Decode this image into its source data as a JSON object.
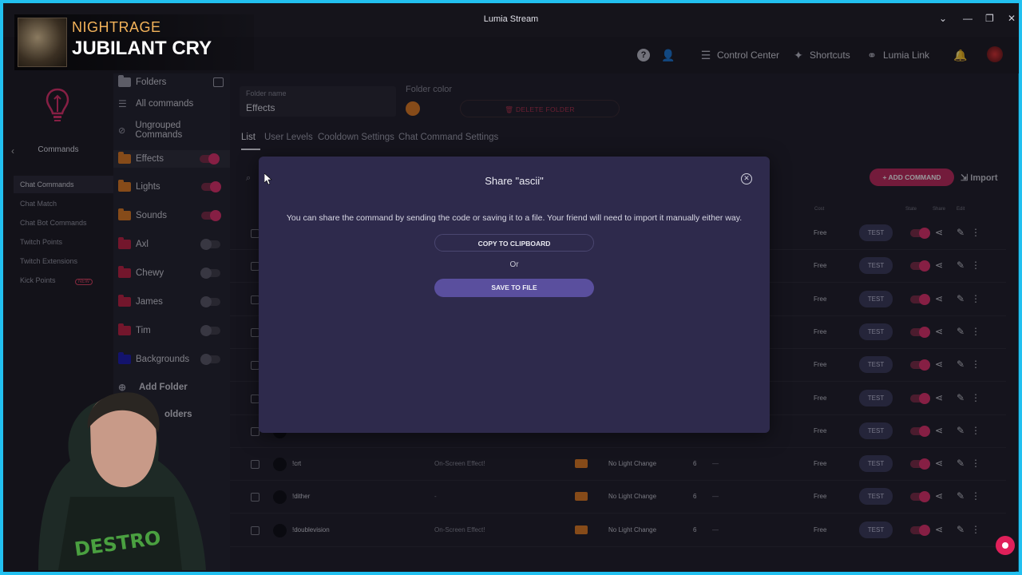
{
  "window": {
    "title": "Lumia Stream"
  },
  "now_playing": {
    "artist": "NIGHTRAGE",
    "song": "JUBILANT CRY"
  },
  "header": {
    "control_center": "Control Center",
    "shortcuts": "Shortcuts",
    "lumia_link": "Lumia Link"
  },
  "leftnav": {
    "title": "Commands",
    "items": [
      {
        "label": "Chat Commands"
      },
      {
        "label": "Chat Match"
      },
      {
        "label": "Chat Bot Commands"
      },
      {
        "label": "Twitch Points"
      },
      {
        "label": "Twitch Extensions"
      },
      {
        "label": "Kick Points",
        "badge": "NEW"
      }
    ]
  },
  "folders": {
    "header": "Folders",
    "all": "All commands",
    "ungrouped": "Ungrouped Commands",
    "list": [
      {
        "label": "Effects",
        "color": "#e07a20",
        "on": true
      },
      {
        "label": "Lights",
        "color": "#e07a20",
        "on": true
      },
      {
        "label": "Sounds",
        "color": "#e07a20",
        "on": true
      },
      {
        "label": "Axl",
        "color": "#c02040",
        "on": false
      },
      {
        "label": "Chewy",
        "color": "#c02040",
        "on": false
      },
      {
        "label": "James",
        "color": "#c02040",
        "on": false
      },
      {
        "label": "Tim",
        "color": "#c02040",
        "on": false
      },
      {
        "label": "Backgrounds",
        "color": "#1a1ab0",
        "on": false
      }
    ],
    "add_folder": "Add Folder",
    "folders_partial": "olders"
  },
  "main": {
    "folder_name_label": "Folder name",
    "folder_name_value": "Effects",
    "folder_color_label": "Folder color",
    "folder_color": "#e07a20",
    "delete_folder": "DELETE FOLDER",
    "tabs": [
      "List",
      "User Levels",
      "Cooldown Settings",
      "Chat Command Settings"
    ],
    "add_command": "ADD COMMAND",
    "import": "Import",
    "columns": {
      "cost": "Cost",
      "state": "State",
      "share": "Share",
      "edit": "Edit"
    },
    "rows": [
      {
        "name": "",
        "desc": "",
        "light": "",
        "num": "",
        "cost": "Free",
        "test": "TEST"
      },
      {
        "name": "",
        "desc": "",
        "light": "",
        "num": "",
        "cost": "Free",
        "test": "TEST"
      },
      {
        "name": "",
        "desc": "",
        "light": "",
        "num": "",
        "cost": "Free",
        "test": "TEST"
      },
      {
        "name": "",
        "desc": "",
        "light": "",
        "num": "",
        "cost": "Free",
        "test": "TEST"
      },
      {
        "name": "",
        "desc": "",
        "light": "",
        "num": "",
        "cost": "Free",
        "test": "TEST"
      },
      {
        "name": "",
        "desc": "",
        "light": "",
        "num": "",
        "cost": "Free",
        "test": "TEST"
      },
      {
        "name": "",
        "desc": "",
        "light": "",
        "num": "",
        "cost": "Free",
        "test": "TEST"
      },
      {
        "name": "!crt",
        "desc": "On-Screen Effect!",
        "light": "No Light Change",
        "num": "6",
        "dash": "—",
        "cost": "Free",
        "test": "TEST"
      },
      {
        "name": "!dither",
        "desc": "-",
        "light": "No Light Change",
        "num": "6",
        "dash": "—",
        "cost": "Free",
        "test": "TEST"
      },
      {
        "name": "!doublevision",
        "desc": "On-Screen Effect!",
        "light": "No Light Change",
        "num": "6",
        "dash": "—",
        "cost": "Free",
        "test": "TEST"
      }
    ]
  },
  "modal": {
    "title": "Share \"ascii\"",
    "description": "You can share the command by sending the code or saving it to a file. Your friend will need to import it manually either way.",
    "copy_button": "COPY TO CLIPBOARD",
    "or": "Or",
    "save_button": "SAVE TO FILE"
  },
  "colors": {
    "accent": "#e0306a",
    "frame": "#22c0f0",
    "modal_bg": "#2e2a4c",
    "save_button": "#5a4f9e"
  }
}
